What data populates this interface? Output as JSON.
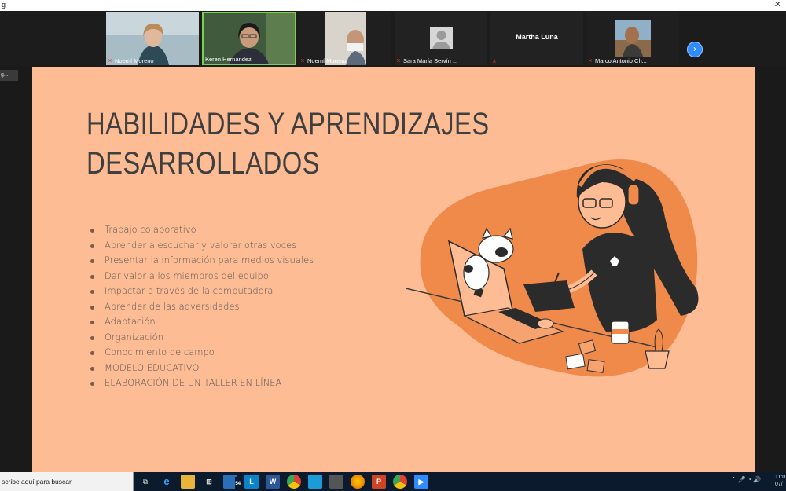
{
  "window": {
    "title": "g",
    "close_glyph": "✕"
  },
  "participants": [
    {
      "name": "Noemí Moreno",
      "muted": true
    },
    {
      "name": "Keren Hernández",
      "muted": false,
      "active_speaker": true
    },
    {
      "name": "Noemí Moreno",
      "muted": true
    },
    {
      "name": "Sara María Servín ...",
      "muted": true,
      "avatar": "user-placeholder-icon"
    },
    {
      "name": "Martha Luna",
      "muted": true,
      "name_only": true
    },
    {
      "name": "Marco Antonio Ch...",
      "muted": true
    }
  ],
  "next_page_glyph": "›",
  "left_pill": "g...",
  "slide": {
    "title_line1": "HABILIDADES Y APRENDIZAJES",
    "title_line2": "DESARROLLADOS",
    "bullets": [
      "Trabajo colaborativo",
      "Aprender a escuchar y valorar otras voces",
      "Presentar la información para medios visuales",
      "Dar valor a los miembros del equipo",
      "Impactar a través de la computadora",
      "Aprender de las adversidades",
      "Adaptación",
      "Organización",
      "Conocimiento de campo",
      "MODELO EDUCATIVO",
      "ELABORACIÓN DE UN TALLER EN LÍNEA"
    ]
  },
  "colors": {
    "slide_bg": "#fdbc93",
    "accent": "#f08a4b",
    "zoom_blue": "#2d8cff"
  },
  "taskbar": {
    "search_placeholder": "scribe aquí para buscar",
    "mail_badge": "54",
    "apps": [
      "task-view-icon",
      "edge-icon",
      "file-explorer-icon",
      "store-icon",
      "mail-icon",
      "linkedin-icon",
      "word-icon",
      "chrome-icon",
      "calculator-icon",
      "firefox-icon",
      "powerpoint-icon",
      "chrome-alt-icon",
      "zoom-icon"
    ],
    "clock_time": "11:0",
    "clock_date": "07/"
  }
}
